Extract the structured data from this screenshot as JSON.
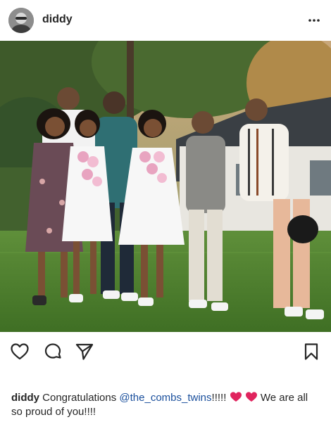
{
  "header": {
    "username": "diddy",
    "avatar_icon": "profile-avatar",
    "more_icon": "more-options-icon"
  },
  "post": {
    "photo_alt": "Family group photo in backyard"
  },
  "actions": {
    "like_icon": "heart-outline-icon",
    "comment_icon": "comment-bubble-icon",
    "share_icon": "paper-plane-icon",
    "save_icon": "bookmark-icon"
  },
  "caption": {
    "username": "diddy",
    "text_before": " Congratulations ",
    "mention": "@the_combs_twins",
    "text_after": "!!!!!",
    "text_end": " We are all so proud of you!!!!"
  },
  "colors": {
    "text": "#262626",
    "mention": "#1a4f9c",
    "heart": "#e0245e"
  }
}
